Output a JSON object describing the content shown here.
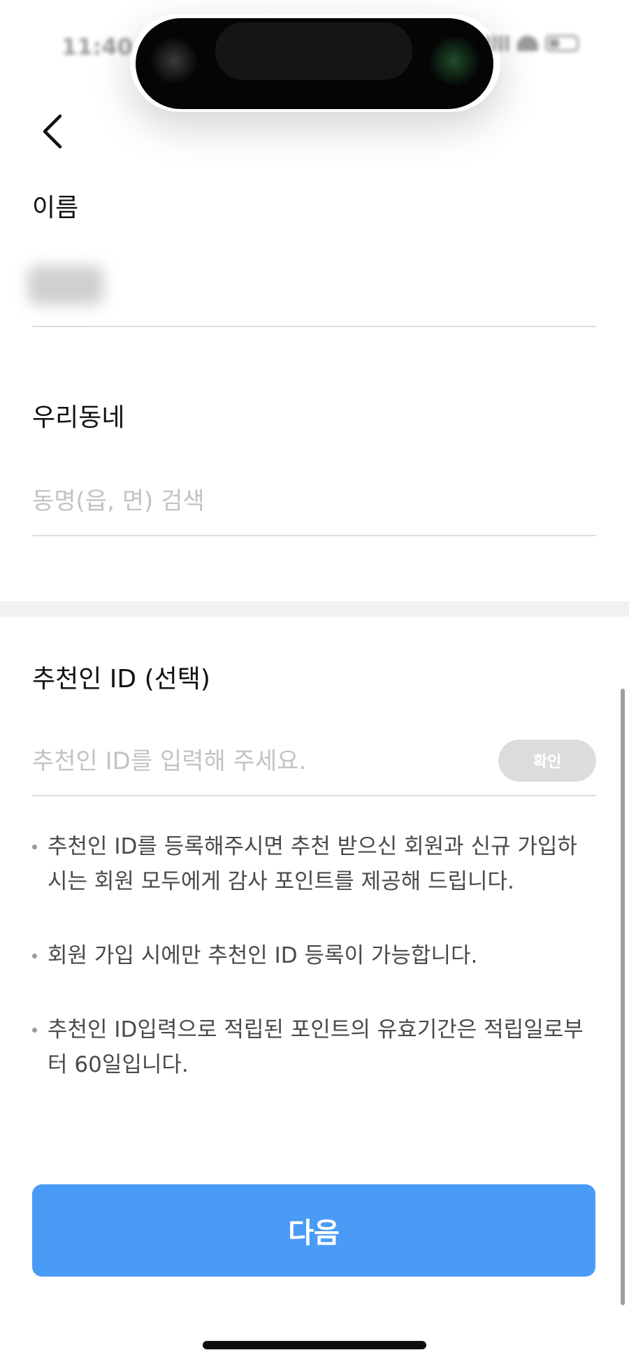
{
  "status_bar": {
    "time": "11:40"
  },
  "header": {
    "back_icon": "chevron-left-icon"
  },
  "name_field": {
    "label": "이름"
  },
  "neighborhood_field": {
    "label": "우리동네",
    "placeholder": "동명(읍, 면) 검색"
  },
  "referrer_field": {
    "label": "추천인 ID (선택)",
    "placeholder": "추천인 ID를 입력해 주세요.",
    "confirm_label": "확인"
  },
  "notes": [
    "추천인 ID를 등록해주시면 추천 받으신 회원과 신규 가입하시는 회원 모두에게 감사 포인트를 제공해 드립니다.",
    "회원 가입 시에만 추천인 ID 등록이 가능합니다.",
    "추천인 ID입력으로 적립된 포인트의 유효기간은 적립일로부터 60일입니다."
  ],
  "next_button": {
    "label": "다음"
  },
  "colors": {
    "primary": "#4a9bf6",
    "confirm_disabled": "#dcdcdc",
    "placeholder": "#c3c3c3"
  }
}
